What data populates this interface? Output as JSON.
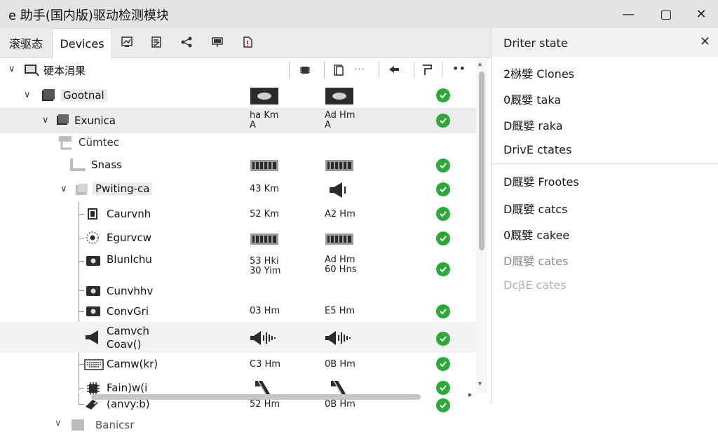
{
  "window": {
    "title": "e 助手(国内版)驱动检测模块",
    "minimize_glyph": "—",
    "maximize_glyph": "▢",
    "close_glyph": "✕"
  },
  "tabs": [
    {
      "label": "滚驱态"
    },
    {
      "label": "Devices"
    }
  ],
  "tree": {
    "root_label": "硬本涓果",
    "rows": [
      {
        "label": "Gootnal",
        "col1": "",
        "col2": ""
      },
      {
        "label": "Exunica",
        "col1": "ha Km\nA",
        "col2": "Ad Hm\nA"
      },
      {
        "label": "Cümtec",
        "col1": "",
        "col2": ""
      },
      {
        "label": "Snass",
        "col1": "",
        "col2": ""
      },
      {
        "label": "Pwiting-ca",
        "col1": "43 Km",
        "col2": ""
      },
      {
        "label": "Caurvnh",
        "col1": "52 Km",
        "col2": "A2 Hm"
      },
      {
        "label": "Egurvcw",
        "col1": "",
        "col2": ""
      },
      {
        "label": "Blunlchu",
        "col1": "53 Hki\n30 Yim",
        "col2": "Ad Hm\n60 Hns"
      },
      {
        "label": "Cunvhhv",
        "col1": "",
        "col2": ""
      },
      {
        "label": "ConvGri",
        "col1": "03 Hm",
        "col2": "E5 Hm"
      },
      {
        "label": "Camvch\nCoav()",
        "col1": "",
        "col2": ""
      },
      {
        "label": "Camw(kr)",
        "col1": "C3 Hm",
        "col2": "0B Hm"
      },
      {
        "label": "Fain)w(i",
        "col1": "",
        "col2": ""
      },
      {
        "label": "(anvy:b)",
        "col1": "52 Hm",
        "col2": "0B Hm"
      },
      {
        "label": "Banicsr",
        "col1": "",
        "col2": ""
      }
    ]
  },
  "details": {
    "title": "Driter state",
    "items": [
      "2椕嬖 Clones",
      "0厩嬖 taka",
      "D厩嬖 raka",
      "DrivE ctates",
      "D厩嬖 Frootes",
      "D厩嬖 catcs",
      "0厩嬖 cakee",
      "D厩嬖 cates",
      "DcβE cates"
    ]
  },
  "colors": {
    "titlebar": "#e4e4e4",
    "status_ok": "#2fa83a",
    "selected_row": "#ececec"
  }
}
